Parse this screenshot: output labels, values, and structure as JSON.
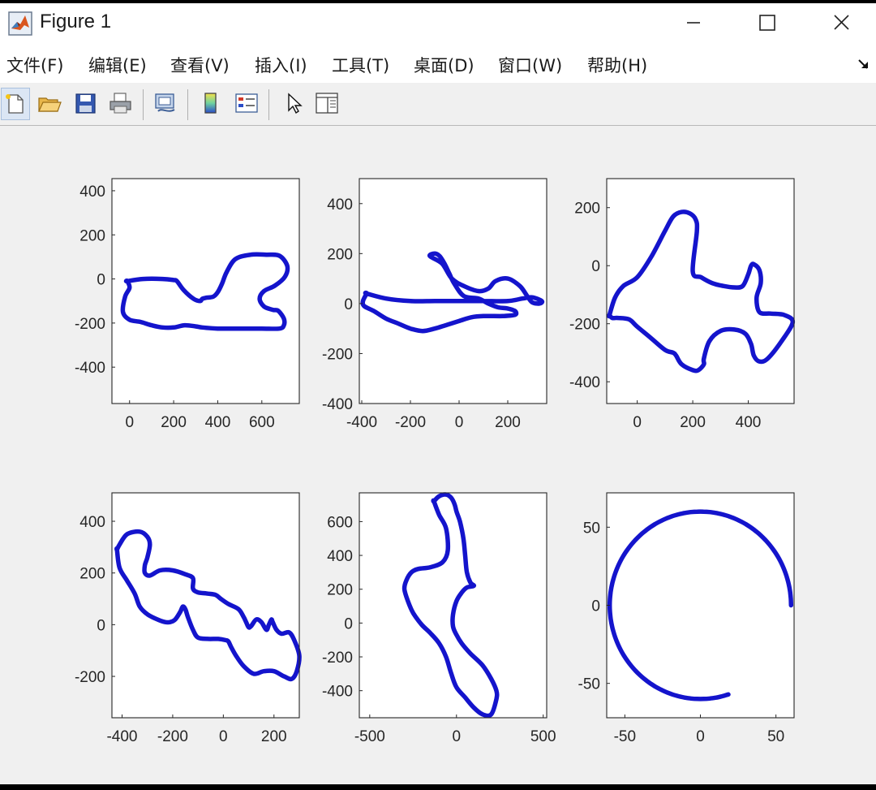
{
  "window": {
    "title": "Figure 1"
  },
  "menu": [
    {
      "label": "文件(F)"
    },
    {
      "label": "编辑(E)"
    },
    {
      "label": "查看(V)"
    },
    {
      "label": "插入(I)"
    },
    {
      "label": "工具(T)"
    },
    {
      "label": "桌面(D)"
    },
    {
      "label": "窗口(W)"
    },
    {
      "label": "帮助(H)"
    }
  ],
  "toolbar": [
    {
      "name": "new-figure-icon"
    },
    {
      "name": "open-file-icon"
    },
    {
      "name": "save-figure-icon"
    },
    {
      "name": "print-figure-icon"
    },
    {
      "name": "link-plot-icon"
    },
    {
      "name": "insert-colorbar-icon"
    },
    {
      "name": "insert-legend-icon"
    },
    {
      "name": "edit-plot-arrow-icon"
    },
    {
      "name": "property-inspector-icon"
    }
  ],
  "colors": {
    "line": "#1414cc",
    "axes_bg": "#ffffff",
    "figure_bg": "#f0f0f0"
  },
  "chart_data": [
    {
      "type": "line",
      "title": "",
      "xlabel": "",
      "ylabel": "",
      "xlim": [
        -80,
        770
      ],
      "ylim": [
        -565,
        455
      ],
      "xticks": [
        0,
        200,
        400,
        600
      ],
      "yticks": [
        400,
        200,
        0,
        -200,
        -400
      ],
      "series": [
        {
          "closed": true,
          "x": [
            -10,
            60,
            150,
            200,
            215,
            245,
            290,
            320,
            330,
            350,
            380,
            400,
            420,
            440,
            480,
            550,
            620,
            680,
            715,
            705,
            660,
            610,
            590,
            610,
            650,
            675,
            700,
            700,
            680,
            600,
            500,
            400,
            330,
            300,
            250,
            200,
            150,
            100,
            50,
            0,
            -30,
            -20,
            0,
            -10
          ],
          "y": [
            -10,
            0,
            0,
            -5,
            -10,
            -50,
            -90,
            -100,
            -90,
            -85,
            -80,
            -60,
            -20,
            30,
            90,
            110,
            110,
            105,
            60,
            10,
            -30,
            -55,
            -90,
            -125,
            -140,
            -145,
            -180,
            -210,
            -225,
            -225,
            -225,
            -225,
            -220,
            -215,
            -210,
            -220,
            -220,
            -210,
            -195,
            -185,
            -150,
            -80,
            -40,
            -10
          ]
        }
      ]
    },
    {
      "type": "line",
      "title": "",
      "xlabel": "",
      "ylabel": "",
      "xlim": [
        -410,
        360
      ],
      "ylim": [
        -400,
        500
      ],
      "xticks": [
        -400,
        -200,
        0,
        200
      ],
      "yticks": [
        400,
        200,
        0,
        -200,
        -400
      ],
      "series": [
        {
          "closed": true,
          "x": [
            -380,
            -300,
            -200,
            -100,
            0,
            100,
            200,
            260,
            300,
            340,
            330,
            300,
            280,
            250,
            200,
            150,
            120,
            80,
            20,
            -30,
            -70,
            -120,
            -100,
            -80,
            -60,
            -40,
            -20,
            20,
            80,
            120,
            160,
            200,
            230,
            230,
            180,
            100,
            50,
            0,
            -50,
            -100,
            -150,
            -200,
            -250,
            -300,
            -350,
            -390,
            -395,
            -380
          ],
          "y": [
            40,
            20,
            10,
            10,
            10,
            10,
            10,
            20,
            25,
            10,
            0,
            5,
            30,
            70,
            100,
            90,
            60,
            50,
            70,
            100,
            160,
            190,
            200,
            190,
            160,
            120,
            80,
            30,
            20,
            0,
            -15,
            -20,
            -30,
            -45,
            -50,
            -50,
            -55,
            -70,
            -85,
            -100,
            -110,
            -100,
            -80,
            -60,
            -30,
            -10,
            10,
            40
          ]
        }
      ]
    },
    {
      "type": "line",
      "title": "",
      "xlabel": "",
      "ylabel": "",
      "xlim": [
        -110,
        565
      ],
      "ylim": [
        -475,
        300
      ],
      "xticks": [
        0,
        200,
        400
      ],
      "yticks": [
        200,
        0,
        -200,
        -400
      ],
      "series": [
        {
          "closed": true,
          "x": [
            -100,
            -80,
            -50,
            0,
            50,
            100,
            130,
            160,
            190,
            210,
            215,
            200,
            230,
            270,
            310,
            350,
            380,
            400,
            410,
            420,
            440,
            445,
            430,
            440,
            480,
            530,
            560,
            520,
            470,
            440,
            420,
            410,
            390,
            350,
            300,
            260,
            240,
            240,
            220,
            200,
            160,
            140,
            130,
            100,
            50,
            0,
            -30,
            -70,
            -90,
            -100
          ],
          "y": [
            -170,
            -110,
            -70,
            -40,
            30,
            120,
            170,
            185,
            180,
            160,
            120,
            -20,
            -40,
            -60,
            -70,
            -75,
            -70,
            -30,
            0,
            5,
            -15,
            -60,
            -110,
            -160,
            -165,
            -170,
            -195,
            -260,
            -320,
            -330,
            -310,
            -270,
            -235,
            -220,
            -225,
            -260,
            -320,
            -340,
            -360,
            -360,
            -340,
            -310,
            -300,
            -290,
            -250,
            -210,
            -185,
            -180,
            -180,
            -170
          ]
        }
      ]
    },
    {
      "type": "line",
      "title": "",
      "xlabel": "",
      "ylabel": "",
      "xlim": [
        -440,
        300
      ],
      "ylim": [
        -360,
        510
      ],
      "xticks": [
        -400,
        -200,
        0,
        200
      ],
      "yticks": [
        400,
        200,
        0,
        -200
      ],
      "series": [
        {
          "closed": true,
          "x": [
            -420,
            -410,
            -380,
            -330,
            -300,
            -290,
            -300,
            -310,
            -310,
            -290,
            -250,
            -200,
            -150,
            -120,
            -120,
            -100,
            -60,
            -30,
            -10,
            20,
            60,
            80,
            90,
            100,
            110,
            130,
            150,
            170,
            180,
            190,
            195,
            210,
            230,
            260,
            280,
            300,
            290,
            270,
            240,
            200,
            160,
            120,
            80,
            50,
            30,
            20,
            10,
            -20,
            -60,
            -100,
            -120,
            -140,
            -150,
            -160,
            -170,
            -190,
            -210,
            -230,
            -260,
            -300,
            -330,
            -350,
            -380,
            -410,
            -420
          ],
          "y": [
            290,
            310,
            350,
            360,
            340,
            310,
            260,
            230,
            200,
            190,
            210,
            210,
            195,
            180,
            140,
            125,
            120,
            115,
            100,
            80,
            60,
            30,
            10,
            -10,
            -5,
            20,
            10,
            -20,
            0,
            20,
            10,
            -20,
            -35,
            -30,
            -60,
            -120,
            -180,
            -210,
            -200,
            -180,
            -180,
            -190,
            -160,
            -120,
            -85,
            -65,
            -60,
            -55,
            -55,
            -50,
            -20,
            30,
            60,
            70,
            50,
            20,
            10,
            10,
            20,
            40,
            70,
            120,
            170,
            220,
            290
          ]
        }
      ]
    },
    {
      "type": "line",
      "title": "",
      "xlabel": "",
      "ylabel": "",
      "xlim": [
        -560,
        520
      ],
      "ylim": [
        -560,
        770
      ],
      "xticks": [
        -500,
        0,
        500
      ],
      "yticks": [
        600,
        400,
        200,
        0,
        -200,
        -400
      ],
      "series": [
        {
          "closed": true,
          "x": [
            -130,
            -100,
            -60,
            -30,
            -10,
            0,
            20,
            40,
            50,
            60,
            80,
            100,
            60,
            30,
            0,
            -20,
            -20,
            0,
            30,
            80,
            150,
            200,
            230,
            230,
            200,
            150,
            100,
            50,
            0,
            -30,
            -60,
            -100,
            -150,
            -200,
            -250,
            -280,
            -300,
            -290,
            -260,
            -220,
            -150,
            -80,
            -50,
            -60,
            -100,
            -130
          ],
          "y": [
            720,
            750,
            760,
            740,
            700,
            660,
            600,
            500,
            400,
            300,
            240,
            220,
            210,
            180,
            130,
            50,
            -20,
            -70,
            -120,
            -180,
            -250,
            -330,
            -400,
            -450,
            -540,
            -540,
            -500,
            -440,
            -380,
            -300,
            -200,
            -120,
            -60,
            -10,
            60,
            130,
            200,
            250,
            300,
            320,
            330,
            360,
            430,
            560,
            640,
            720
          ]
        }
      ]
    },
    {
      "type": "line",
      "title": "",
      "xlabel": "",
      "ylabel": "",
      "xlim": [
        -62,
        62
      ],
      "ylim": [
        -72,
        72
      ],
      "xticks": [
        -50,
        0,
        50
      ],
      "yticks": [
        50,
        0,
        -50
      ],
      "series": [
        {
          "closed": false,
          "arc": {
            "cx": 0,
            "cy": 0,
            "r": 60,
            "start_deg": 0,
            "end_deg": 288
          }
        }
      ]
    }
  ]
}
